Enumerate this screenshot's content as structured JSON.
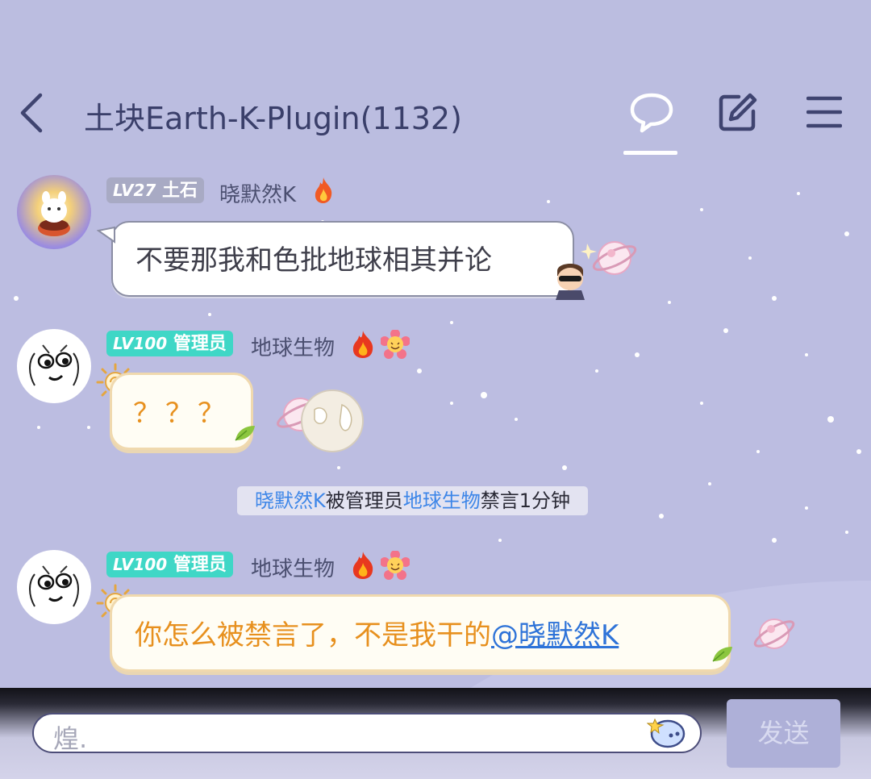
{
  "header": {
    "title": "土块Earth-K-Plugin(1132)",
    "icons": [
      "back-arrow-icon",
      "chat-bubble-icon",
      "edit-icon",
      "menu-icon"
    ]
  },
  "messages": [
    {
      "level": "LV27",
      "title": "土石",
      "name": "晓默然K",
      "badges": [
        "fire-icon"
      ],
      "text": "不要那我和色批地球相其并论"
    },
    {
      "level": "LV100",
      "title": "管理员",
      "name": "地球生物",
      "badges": [
        "fire-icon",
        "flower-face-icon"
      ],
      "text": "？？？"
    },
    {
      "level": "LV100",
      "title": "管理员",
      "name": "地球生物",
      "badges": [
        "fire-icon",
        "flower-face-icon"
      ],
      "text": "你怎么被禁言了，不是我干的",
      "mention": "@晓默然K"
    }
  ],
  "system_notice": {
    "user": "晓默然K",
    "middle": "被管理员",
    "admin": "地球生物",
    "end": "禁言1分钟"
  },
  "input": {
    "value": "煌.",
    "emoji_icon": "sticker-icon"
  },
  "send_label": "发送",
  "colors": {
    "header_bg": "#bbbde0",
    "chat_bg": "#bcbde1",
    "accent_teal": "#3fd7c6",
    "mention_blue": "#2e73d8",
    "orange_text": "#e7901e"
  }
}
